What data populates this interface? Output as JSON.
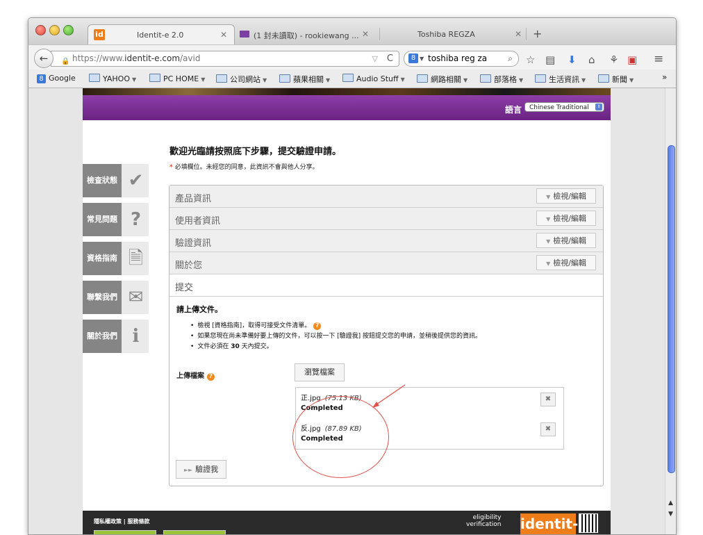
{
  "tabs": [
    {
      "favicon": "id",
      "title": "Identit-e 2.0"
    },
    {
      "title": "(1 封未讀取) - rookiewang ..."
    },
    {
      "title": "Toshiba REGZA"
    }
  ],
  "navbar": {
    "url_prefix": "https://www.",
    "url_domain": "identit-e.com",
    "url_path": "/avid",
    "search_query": "toshiba reg za"
  },
  "bookmarks": [
    "Google",
    "YAHOO",
    "PC HOME",
    "公司網站",
    "蘋果相關",
    "Audio Stuff",
    "網路相關",
    "部落格",
    "生活資訊",
    "新聞"
  ],
  "header": {
    "language_label": "語言",
    "language_value": "Chinese Traditional"
  },
  "side_menu": [
    {
      "label": "檢查狀態",
      "icon": "checkmark-icon"
    },
    {
      "label": "常見問題",
      "icon": "question-icon"
    },
    {
      "label": "資格指南",
      "icon": "document-icon"
    },
    {
      "label": "聯繫我們",
      "icon": "mail-icon"
    },
    {
      "label": "關於我們",
      "icon": "info-icon"
    }
  ],
  "main": {
    "heading": "歡迎光臨請按照底下步驟，提交驗證申請。",
    "required_star": "*",
    "required_note": "必填欄位。未經您的同意，此資訊不會與他人分享。",
    "sections": [
      {
        "title": "產品資訊",
        "button": "檢視/編輯"
      },
      {
        "title": "使用者資訊",
        "button": "檢視/編輯"
      },
      {
        "title": "驗證資訊",
        "button": "檢視/編輯"
      },
      {
        "title": "關於您",
        "button": "檢視/編輯"
      }
    ],
    "submit_section": "提交",
    "upload_prompt": "請上傳文件。",
    "bullet1": "檢視 [資格指南]，取得可接受文件清單。",
    "bullet2": "如果您現在尚未準備好要上傳的文件，可以按一下 [驗證我] 按鈕提交您的申請，並稍後提供您的資訊。",
    "bullet3_pre": "文件必須在",
    "bullet3_days": "30",
    "bullet3_post": "天內提交。",
    "upload_label": "上傳檔案",
    "browse_button": "瀏覽檔案",
    "files": [
      {
        "name": "正.jpg",
        "size": "(75.13 KB)",
        "status": "Completed"
      },
      {
        "name": "反.jpg",
        "size": "(87.89 KB)",
        "status": "Completed"
      }
    ],
    "verify_button": "驗證我"
  },
  "footer": {
    "links": "隱私權政策 | 服務條款",
    "tagline1": "eligibility",
    "tagline2": "verification",
    "brand": "identit-e"
  },
  "colors": {
    "purple": "#7a2d93",
    "accent_orange": "#ef7d1a",
    "annotation_red": "#e2504a"
  }
}
